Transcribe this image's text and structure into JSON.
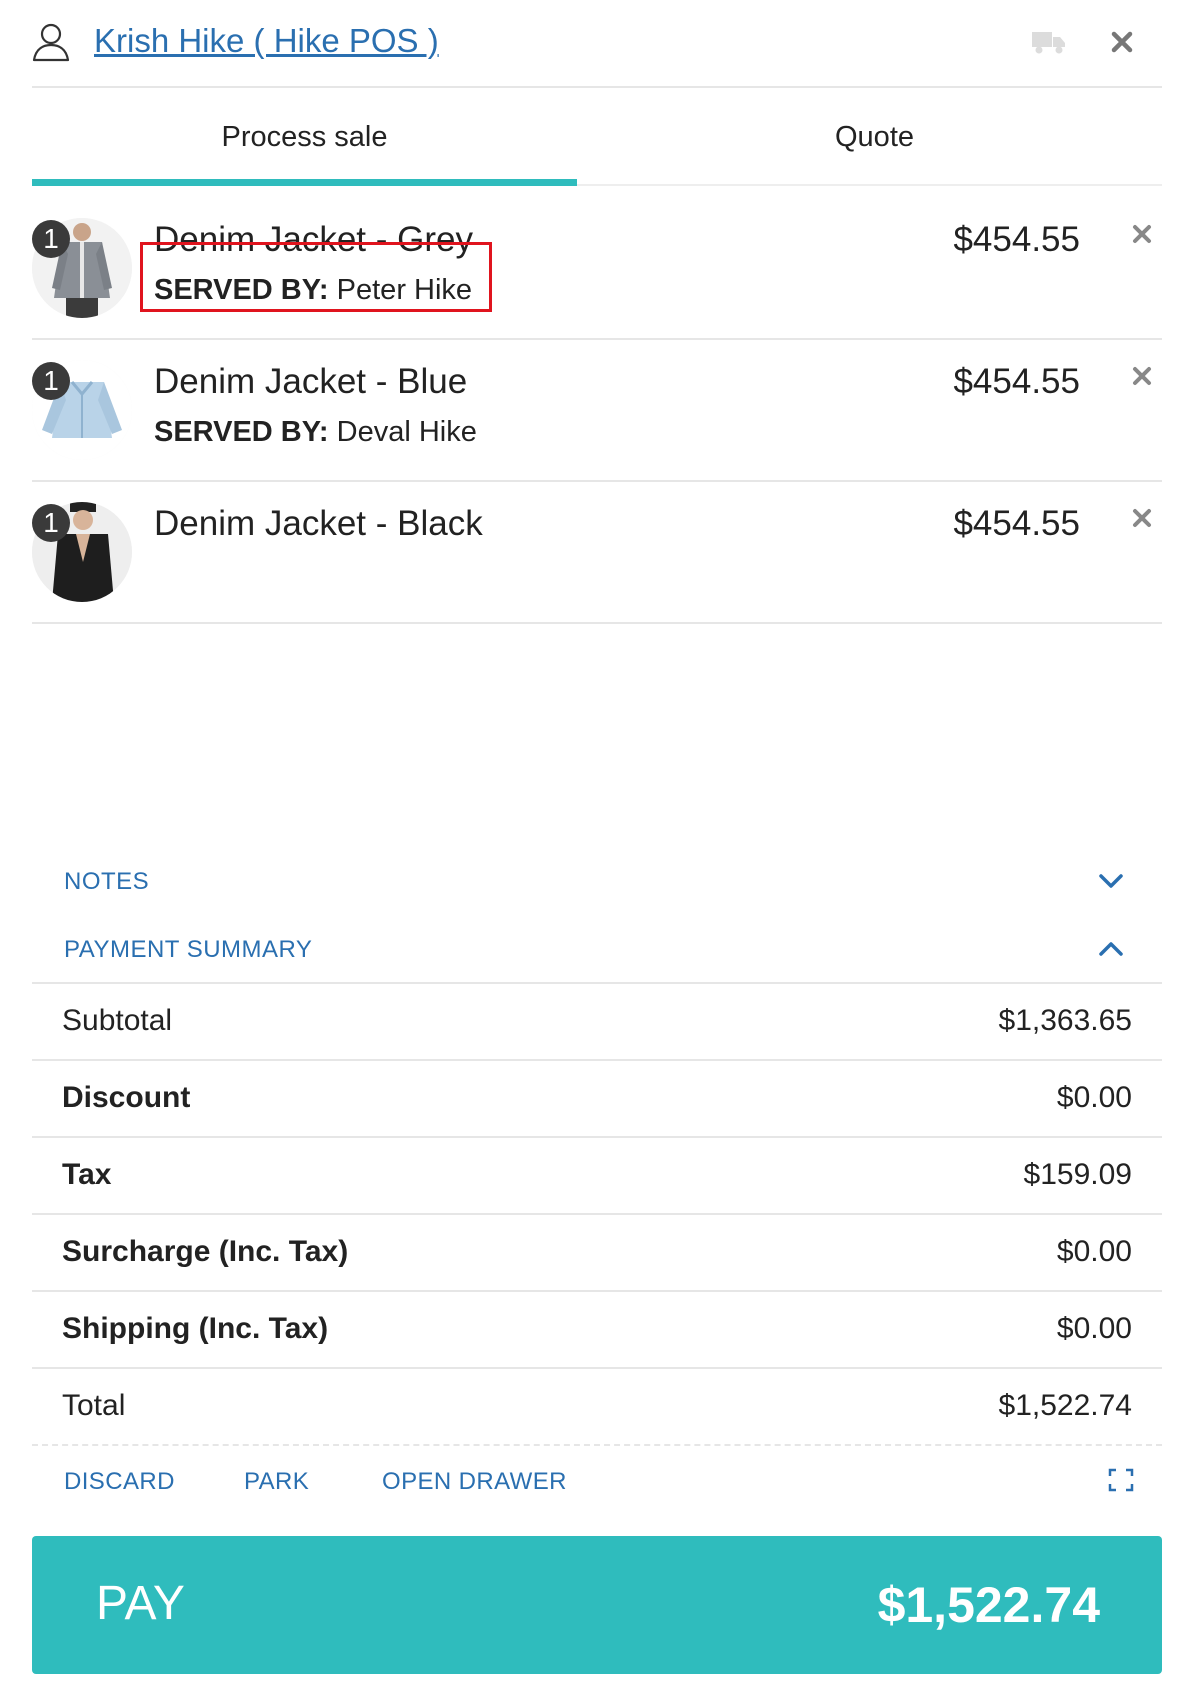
{
  "header": {
    "customer_name": "Krish Hike ( Hike POS )",
    "user_icon": "user-outline-icon",
    "delivery_icon": "truck-icon",
    "close_icon": "close-icon"
  },
  "tabs": [
    {
      "label": "Process sale",
      "active": true
    },
    {
      "label": "Quote",
      "active": false
    }
  ],
  "items": [
    {
      "qty": "1",
      "name": "Denim Jacket - Grey",
      "served_label": "SERVED BY:",
      "served_by": "Peter Hike",
      "price": "$454.55",
      "highlighted": true
    },
    {
      "qty": "1",
      "name": "Denim Jacket - Blue",
      "served_label": "SERVED BY:",
      "served_by": "Deval Hike",
      "price": "$454.55"
    },
    {
      "qty": "1",
      "name": "Denim Jacket - Black",
      "price": "$454.55"
    }
  ],
  "sections": {
    "notes": {
      "label": "NOTES",
      "expanded": false
    },
    "payment_summary": {
      "label": "PAYMENT SUMMARY",
      "expanded": true
    }
  },
  "summary": [
    {
      "label": "Subtotal",
      "value": "$1,363.65"
    },
    {
      "label": "Discount",
      "value": "$0.00"
    },
    {
      "label": "Tax",
      "value": "$159.09"
    },
    {
      "label": "Surcharge (Inc. Tax)",
      "value": "$0.00"
    },
    {
      "label": "Shipping (Inc. Tax)",
      "value": "$0.00"
    },
    {
      "label": "Total",
      "value": "$1,522.74"
    }
  ],
  "actions": {
    "discard": "DISCARD",
    "park": "PARK",
    "open_drawer": "OPEN DRAWER"
  },
  "pay": {
    "label": "PAY",
    "amount": "$1,522.74"
  },
  "colors": {
    "accent": "#2fbcbd",
    "link": "#2a6fb0",
    "highlight": "#e0141e"
  }
}
